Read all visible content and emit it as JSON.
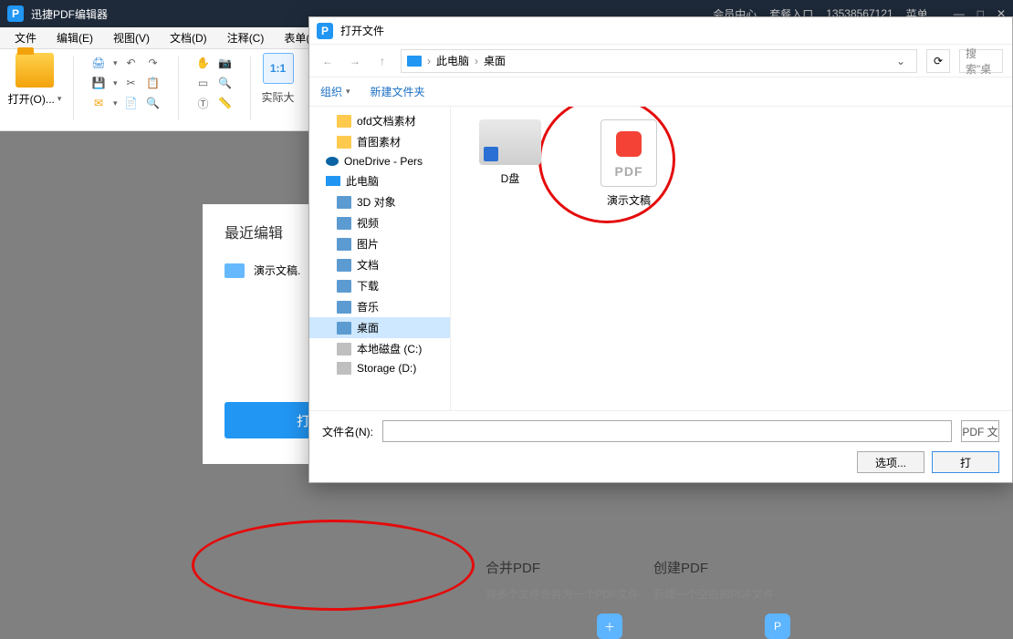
{
  "titlebar": {
    "app_name": "迅捷PDF编辑器",
    "right_items": {
      "member": "会员中心",
      "account": "套餐入口",
      "phone": "13538567121",
      "menu": "菜单"
    },
    "win": {
      "min": "—",
      "max": "□",
      "close": "✕"
    }
  },
  "menubar": {
    "file": "文件",
    "edit": "编辑(E)",
    "view": "视图(V)",
    "doc": "文档(D)",
    "annot": "注释(C)",
    "form": "表单(R)"
  },
  "toolbar": {
    "open_label": "打开(O)...",
    "fit_label": "实际大",
    "fit_11": "1:1"
  },
  "recent": {
    "title": "最近编辑",
    "items": [
      {
        "name": "演示文稿."
      }
    ],
    "open_big": "打开PDF文件"
  },
  "actions": {
    "merge": {
      "title": "合并PDF",
      "desc": "将多个文件合并为一个PDF文件"
    },
    "create": {
      "title": "创建PDF",
      "desc": "新建一个空白的PDF文件"
    }
  },
  "dialog": {
    "title": "打开文件",
    "nav": {
      "back": "←",
      "fwd": "→",
      "up": "↑"
    },
    "breadcrumb": {
      "root": "此电脑",
      "sep": "›",
      "cur": "桌面",
      "drop": "⌄"
    },
    "refresh": "⟳",
    "search_placeholder": "搜索\"桌",
    "toolbar": {
      "org": "组织",
      "newf": "新建文件夹"
    },
    "tree": [
      {
        "label": "ofd文档素材",
        "icon": "fold",
        "sub": true
      },
      {
        "label": "首图素材",
        "icon": "fold",
        "sub": true
      },
      {
        "label": "OneDrive - Pers",
        "icon": "onedrive",
        "sub": false
      },
      {
        "label": "此电脑",
        "icon": "pc",
        "sub": false
      },
      {
        "label": "3D 对象",
        "icon": "gen",
        "sub": true
      },
      {
        "label": "视频",
        "icon": "gen",
        "sub": true
      },
      {
        "label": "图片",
        "icon": "gen",
        "sub": true
      },
      {
        "label": "文档",
        "icon": "gen",
        "sub": true
      },
      {
        "label": "下载",
        "icon": "gen",
        "sub": true
      },
      {
        "label": "音乐",
        "icon": "gen",
        "sub": true
      },
      {
        "label": "桌面",
        "icon": "gen",
        "sub": true,
        "sel": true
      },
      {
        "label": "本地磁盘 (C:)",
        "icon": "disk",
        "sub": true
      },
      {
        "label": "Storage (D:)",
        "icon": "disk",
        "sub": true
      }
    ],
    "files": [
      {
        "name": "D盘",
        "type": "drive"
      },
      {
        "name": "演示文稿",
        "type": "pdf"
      }
    ],
    "footer": {
      "fn_label": "文件名(N):",
      "fn_value": "",
      "type_label": "PDF 文",
      "options": "选项...",
      "open": "打"
    }
  }
}
